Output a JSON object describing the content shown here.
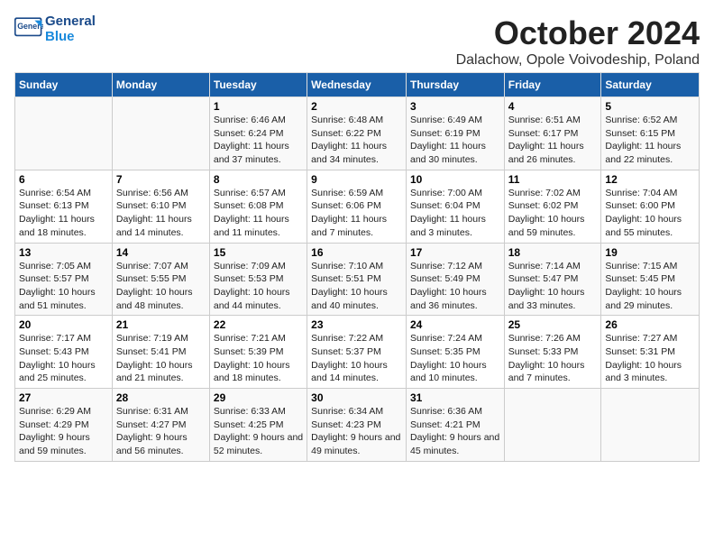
{
  "header": {
    "logo_general": "General",
    "logo_blue": "Blue",
    "month": "October 2024",
    "location": "Dalachow, Opole Voivodeship, Poland"
  },
  "weekdays": [
    "Sunday",
    "Monday",
    "Tuesday",
    "Wednesday",
    "Thursday",
    "Friday",
    "Saturday"
  ],
  "rows": [
    [
      {
        "num": "",
        "info": ""
      },
      {
        "num": "",
        "info": ""
      },
      {
        "num": "1",
        "info": "Sunrise: 6:46 AM\nSunset: 6:24 PM\nDaylight: 11 hours and 37 minutes."
      },
      {
        "num": "2",
        "info": "Sunrise: 6:48 AM\nSunset: 6:22 PM\nDaylight: 11 hours and 34 minutes."
      },
      {
        "num": "3",
        "info": "Sunrise: 6:49 AM\nSunset: 6:19 PM\nDaylight: 11 hours and 30 minutes."
      },
      {
        "num": "4",
        "info": "Sunrise: 6:51 AM\nSunset: 6:17 PM\nDaylight: 11 hours and 26 minutes."
      },
      {
        "num": "5",
        "info": "Sunrise: 6:52 AM\nSunset: 6:15 PM\nDaylight: 11 hours and 22 minutes."
      }
    ],
    [
      {
        "num": "6",
        "info": "Sunrise: 6:54 AM\nSunset: 6:13 PM\nDaylight: 11 hours and 18 minutes."
      },
      {
        "num": "7",
        "info": "Sunrise: 6:56 AM\nSunset: 6:10 PM\nDaylight: 11 hours and 14 minutes."
      },
      {
        "num": "8",
        "info": "Sunrise: 6:57 AM\nSunset: 6:08 PM\nDaylight: 11 hours and 11 minutes."
      },
      {
        "num": "9",
        "info": "Sunrise: 6:59 AM\nSunset: 6:06 PM\nDaylight: 11 hours and 7 minutes."
      },
      {
        "num": "10",
        "info": "Sunrise: 7:00 AM\nSunset: 6:04 PM\nDaylight: 11 hours and 3 minutes."
      },
      {
        "num": "11",
        "info": "Sunrise: 7:02 AM\nSunset: 6:02 PM\nDaylight: 10 hours and 59 minutes."
      },
      {
        "num": "12",
        "info": "Sunrise: 7:04 AM\nSunset: 6:00 PM\nDaylight: 10 hours and 55 minutes."
      }
    ],
    [
      {
        "num": "13",
        "info": "Sunrise: 7:05 AM\nSunset: 5:57 PM\nDaylight: 10 hours and 51 minutes."
      },
      {
        "num": "14",
        "info": "Sunrise: 7:07 AM\nSunset: 5:55 PM\nDaylight: 10 hours and 48 minutes."
      },
      {
        "num": "15",
        "info": "Sunrise: 7:09 AM\nSunset: 5:53 PM\nDaylight: 10 hours and 44 minutes."
      },
      {
        "num": "16",
        "info": "Sunrise: 7:10 AM\nSunset: 5:51 PM\nDaylight: 10 hours and 40 minutes."
      },
      {
        "num": "17",
        "info": "Sunrise: 7:12 AM\nSunset: 5:49 PM\nDaylight: 10 hours and 36 minutes."
      },
      {
        "num": "18",
        "info": "Sunrise: 7:14 AM\nSunset: 5:47 PM\nDaylight: 10 hours and 33 minutes."
      },
      {
        "num": "19",
        "info": "Sunrise: 7:15 AM\nSunset: 5:45 PM\nDaylight: 10 hours and 29 minutes."
      }
    ],
    [
      {
        "num": "20",
        "info": "Sunrise: 7:17 AM\nSunset: 5:43 PM\nDaylight: 10 hours and 25 minutes."
      },
      {
        "num": "21",
        "info": "Sunrise: 7:19 AM\nSunset: 5:41 PM\nDaylight: 10 hours and 21 minutes."
      },
      {
        "num": "22",
        "info": "Sunrise: 7:21 AM\nSunset: 5:39 PM\nDaylight: 10 hours and 18 minutes."
      },
      {
        "num": "23",
        "info": "Sunrise: 7:22 AM\nSunset: 5:37 PM\nDaylight: 10 hours and 14 minutes."
      },
      {
        "num": "24",
        "info": "Sunrise: 7:24 AM\nSunset: 5:35 PM\nDaylight: 10 hours and 10 minutes."
      },
      {
        "num": "25",
        "info": "Sunrise: 7:26 AM\nSunset: 5:33 PM\nDaylight: 10 hours and 7 minutes."
      },
      {
        "num": "26",
        "info": "Sunrise: 7:27 AM\nSunset: 5:31 PM\nDaylight: 10 hours and 3 minutes."
      }
    ],
    [
      {
        "num": "27",
        "info": "Sunrise: 6:29 AM\nSunset: 4:29 PM\nDaylight: 9 hours and 59 minutes."
      },
      {
        "num": "28",
        "info": "Sunrise: 6:31 AM\nSunset: 4:27 PM\nDaylight: 9 hours and 56 minutes."
      },
      {
        "num": "29",
        "info": "Sunrise: 6:33 AM\nSunset: 4:25 PM\nDaylight: 9 hours and 52 minutes."
      },
      {
        "num": "30",
        "info": "Sunrise: 6:34 AM\nSunset: 4:23 PM\nDaylight: 9 hours and 49 minutes."
      },
      {
        "num": "31",
        "info": "Sunrise: 6:36 AM\nSunset: 4:21 PM\nDaylight: 9 hours and 45 minutes."
      },
      {
        "num": "",
        "info": ""
      },
      {
        "num": "",
        "info": ""
      }
    ]
  ]
}
